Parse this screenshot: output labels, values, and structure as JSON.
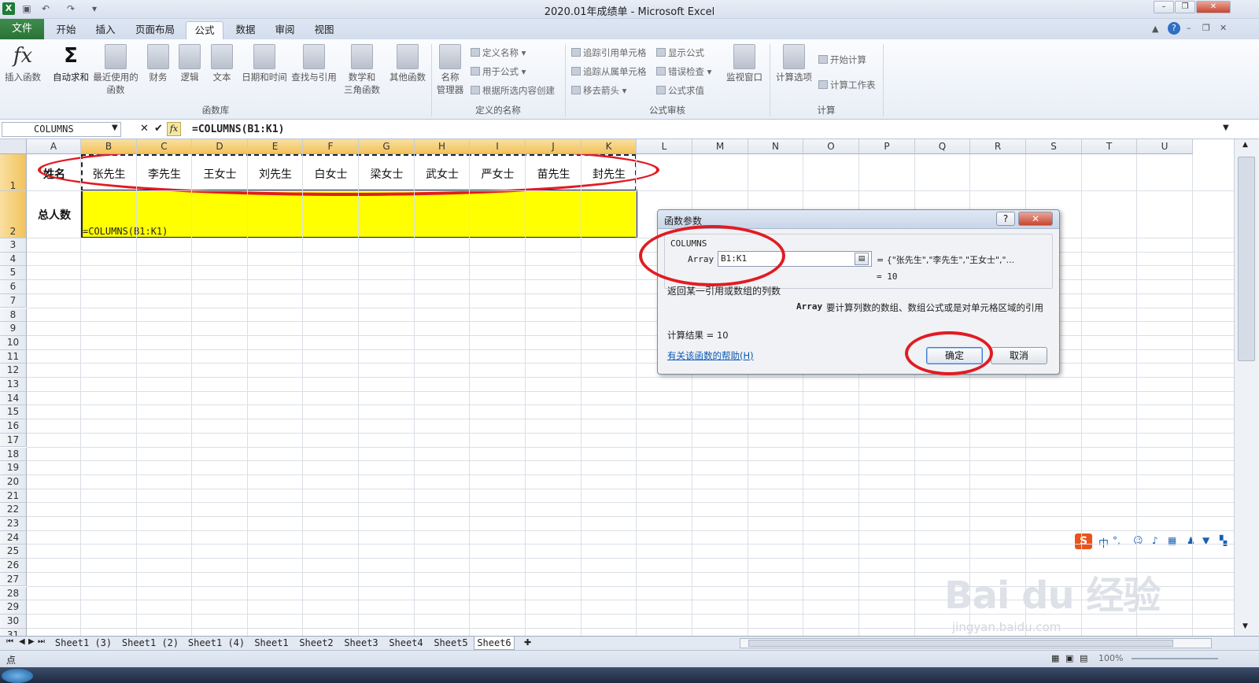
{
  "window": {
    "title": "2020.01年成绩单 - Microsoft Excel"
  },
  "tabs": [
    "文件",
    "开始",
    "插入",
    "页面布局",
    "公式",
    "数据",
    "审阅",
    "视图"
  ],
  "active_tab": "公式",
  "ribbon": {
    "g1": {
      "insert_fn": "插入函数",
      "autosum": "自动求和",
      "recent": "最近使用的",
      "recent2": "函数",
      "finance": "财务",
      "logic": "逻辑",
      "text": "文本",
      "datetime": "日期和时间",
      "lookup": "查找与引用",
      "math": "数学和",
      "math2": "三角函数",
      "other": "其他函数",
      "label": "函数库"
    },
    "g2": {
      "name_mgr": "名称",
      "name_mgr2": "管理器",
      "define": "定义名称",
      "use": "用于公式",
      "create": "根据所选内容创建",
      "label": "定义的名称"
    },
    "g3": {
      "trace_prec": "追踪引用单元格",
      "trace_dep": "追踪从属单元格",
      "remove": "移去箭头",
      "show": "显示公式",
      "check": "错误检查",
      "eval": "公式求值",
      "watch": "监视窗口",
      "label": "公式审核"
    },
    "g4": {
      "calc_opt": "计算选项",
      "calc_now": "开始计算",
      "calc_sheet": "计算工作表",
      "label": "计算"
    }
  },
  "formula_bar": {
    "name_box": "COLUMNS",
    "formula": "=COLUMNS(B1:K1)"
  },
  "columns": [
    "A",
    "B",
    "C",
    "D",
    "E",
    "F",
    "G",
    "H",
    "I",
    "J",
    "K",
    "L",
    "M",
    "N",
    "O",
    "P",
    "Q",
    "R",
    "S",
    "T",
    "U"
  ],
  "rows": [
    "1",
    "2",
    "3",
    "4",
    "5",
    "6",
    "7",
    "8",
    "9",
    "10",
    "11",
    "12",
    "13",
    "14",
    "15",
    "16",
    "17",
    "18",
    "19",
    "20",
    "21",
    "22",
    "23",
    "24",
    "25",
    "26",
    "27",
    "28",
    "29",
    "30",
    "31"
  ],
  "cells": {
    "a1": "姓名",
    "names": [
      "张先生",
      "李先生",
      "王女士",
      "刘先生",
      "白女士",
      "梁女士",
      "武女士",
      "严女士",
      "苗先生",
      "封先生"
    ],
    "a2": "总人数",
    "b2": "=COLUMNS(B1:K1)"
  },
  "dialog": {
    "title": "函数参数",
    "fn": "COLUMNS",
    "arg_label": "Array",
    "arg_value": "B1:K1",
    "arg_result": "= {\"张先生\",\"李先生\",\"王女士\",\"...",
    "result_eq": "= 10",
    "desc": "返回某一引用或数组的列数",
    "arg_desc_name": "Array",
    "arg_desc": "要计算列数的数组、数组公式或是对单元格区域的引用",
    "calc_result": "计算结果 = 10",
    "help": "有关该函数的帮助(H)",
    "ok": "确定",
    "cancel": "取消",
    "question": "?",
    "close": "✕"
  },
  "sheets": [
    "Sheet1 (3)",
    "Sheet1 (2)",
    "Sheet1 (4)",
    "Sheet1",
    "Sheet2",
    "Sheet3",
    "Sheet4",
    "Sheet5",
    "Sheet6"
  ],
  "active_sheet": "Sheet6",
  "status": {
    "mode": "点",
    "zoom": "100%"
  },
  "ime": {
    "lang": "中"
  },
  "watermark": {
    "brand": "Bai du 经验",
    "url": "jingyan.baidu.com"
  }
}
